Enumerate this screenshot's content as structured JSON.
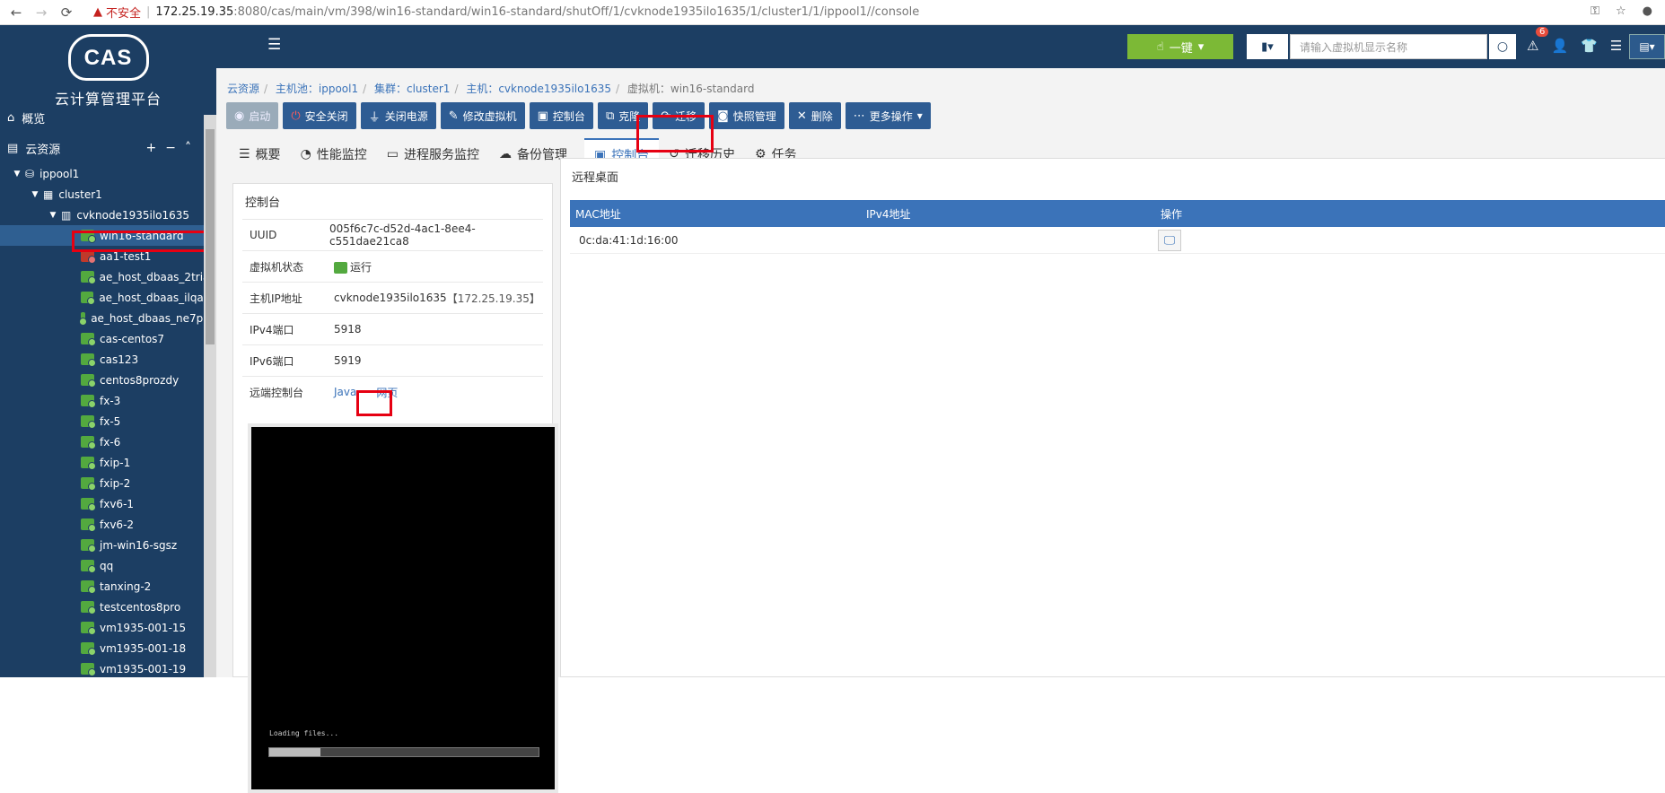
{
  "browser": {
    "warning": "不安全",
    "url_host": "172.25.19.35",
    "url_path": ":8080/cas/main/vm/398/win16-standard/win16-standard/shutOff/1/cvknode1935ilo1635/1/cluster1/1/ippool1//console"
  },
  "sidebar": {
    "logo": "CAS",
    "logo_text": "云计算管理平台",
    "overview": "概览",
    "resources": "云资源",
    "tree": {
      "pool": "ippool1",
      "cluster": "cluster1",
      "host": "cvknode1935ilo1635",
      "vms": [
        {
          "name": "win16-standard",
          "state": "running"
        },
        {
          "name": "aa1-test1",
          "state": "stopped"
        },
        {
          "name": "ae_host_dbaas_2triau",
          "state": "running"
        },
        {
          "name": "ae_host_dbaas_ilqaxx",
          "state": "running"
        },
        {
          "name": "ae_host_dbaas_ne7p9y",
          "state": "running"
        },
        {
          "name": "cas-centos7",
          "state": "running"
        },
        {
          "name": "cas123",
          "state": "running"
        },
        {
          "name": "centos8prozdy",
          "state": "running"
        },
        {
          "name": "fx-3",
          "state": "running"
        },
        {
          "name": "fx-5",
          "state": "running"
        },
        {
          "name": "fx-6",
          "state": "running"
        },
        {
          "name": "fxip-1",
          "state": "running"
        },
        {
          "name": "fxip-2",
          "state": "running"
        },
        {
          "name": "fxv6-1",
          "state": "running"
        },
        {
          "name": "fxv6-2",
          "state": "running"
        },
        {
          "name": "jm-win16-sgsz",
          "state": "running"
        },
        {
          "name": "qq",
          "state": "running"
        },
        {
          "name": "tanxing-2",
          "state": "running"
        },
        {
          "name": "testcentos8pro",
          "state": "running"
        },
        {
          "name": "vm1935-001-15",
          "state": "running"
        },
        {
          "name": "vm1935-001-18",
          "state": "running"
        },
        {
          "name": "vm1935-001-19",
          "state": "running"
        }
      ]
    }
  },
  "topbar": {
    "yijian": "一键",
    "search_placeholder": "请输入虚拟机显示名称",
    "alert_count": "6"
  },
  "breadcrumb": {
    "root": "云资源",
    "pool": "主机池：ippool1",
    "cluster": "集群：cluster1",
    "host": "主机：cvknode1935ilo1635",
    "vm": "虚拟机：win16-standard"
  },
  "toolbar": {
    "start": "启动",
    "safe_shutdown": "安全关闭",
    "power_off": "关闭电源",
    "modify": "修改虚拟机",
    "console": "控制台",
    "clone": "克隆",
    "migrate": "迁移",
    "snapshot": "快照管理",
    "delete": "删除",
    "more": "更多操作"
  },
  "tabs": {
    "summary": "概要",
    "perf": "性能监控",
    "process": "进程服务监控",
    "backup": "备份管理",
    "console": "控制台",
    "migrate_history": "迁移历史",
    "tasks": "任务"
  },
  "console_panel": {
    "title": "控制台",
    "rows": {
      "uuid_k": "UUID",
      "uuid_v": "005f6c7c-d52d-4ac1-8ee4-c551dae21ca8",
      "state_k": "虚拟机状态",
      "state_v": "运行",
      "hostip_k": "主机IP地址",
      "hostip_v": "cvknode1935ilo1635",
      "hostip_ip": "【172.25.19.35】",
      "ipv4_k": "IPv4端口",
      "ipv4_v": "5918",
      "ipv6_k": "IPv6端口",
      "ipv6_v": "5919",
      "remote_k": "远端控制台",
      "java": "Java",
      "web": "网页"
    },
    "loading_text": "Loading files...",
    "loading_progress": 0.19
  },
  "remote_panel": {
    "title": "远程桌面",
    "columns": [
      "MAC地址",
      "IPv4地址",
      "操作"
    ],
    "row": {
      "mac": "0c:da:41:1d:16:00",
      "ipv4": ""
    }
  }
}
